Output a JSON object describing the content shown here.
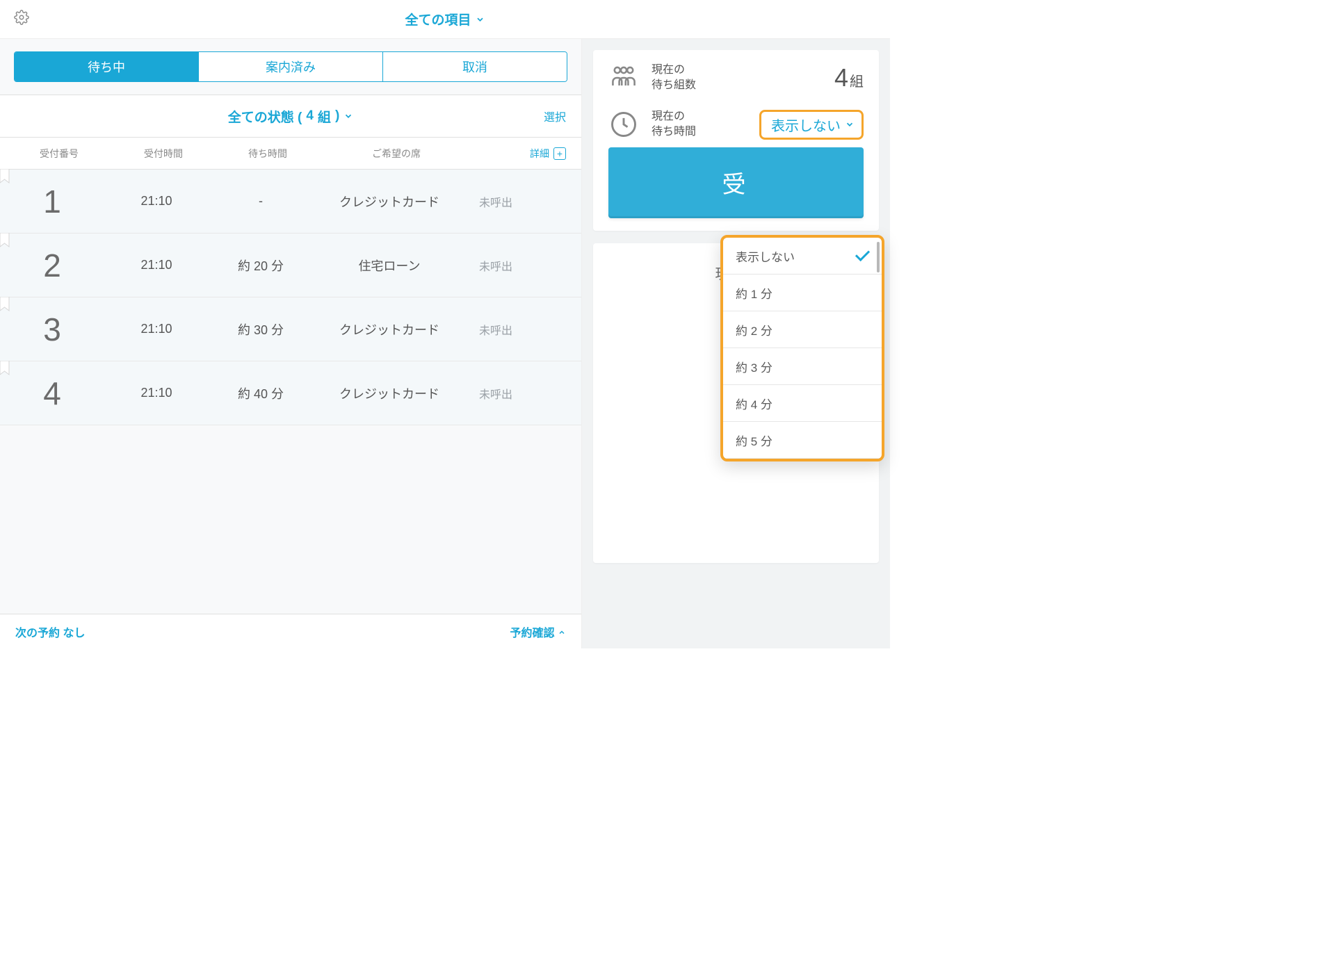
{
  "header": {
    "title": "全ての項目"
  },
  "tabs": {
    "waiting": "待ち中",
    "guided": "案内済み",
    "cancelled": "取消"
  },
  "filter": {
    "label_prefix": "全ての状態 (",
    "count": "4",
    "unit": "組",
    "label_suffix": ")",
    "select_label": "選択"
  },
  "columns": {
    "number": "受付番号",
    "time": "受付時間",
    "wait": "待ち時間",
    "seat": "ご希望の席",
    "detail": "詳細"
  },
  "rows": [
    {
      "num": "1",
      "time": "21:10",
      "wait": "-",
      "seat": "クレジットカード",
      "status": "未呼出"
    },
    {
      "num": "2",
      "time": "21:10",
      "wait": "約 20 分",
      "seat": "住宅ローン",
      "status": "未呼出"
    },
    {
      "num": "3",
      "time": "21:10",
      "wait": "約 30 分",
      "seat": "クレジットカード",
      "status": "未呼出"
    },
    {
      "num": "4",
      "time": "21:10",
      "wait": "約 40 分",
      "seat": "クレジットカード",
      "status": "未呼出"
    }
  ],
  "footer": {
    "next_reservation": "次の予約 なし",
    "confirm": "予約確認"
  },
  "right_panel": {
    "group_label_l1": "現在の",
    "group_label_l2": "待ち組数",
    "group_count": "4",
    "group_unit": "組",
    "time_label_l1": "現在の",
    "time_label_l2": "待ち時間",
    "time_value": "表示しない",
    "big_button": "受",
    "card2_title": "現在呼"
  },
  "dropdown": {
    "options": [
      "表示しない",
      "約 1 分",
      "約 2 分",
      "約 3 分",
      "約 4 分",
      "約 5 分"
    ],
    "selected_index": 0
  }
}
